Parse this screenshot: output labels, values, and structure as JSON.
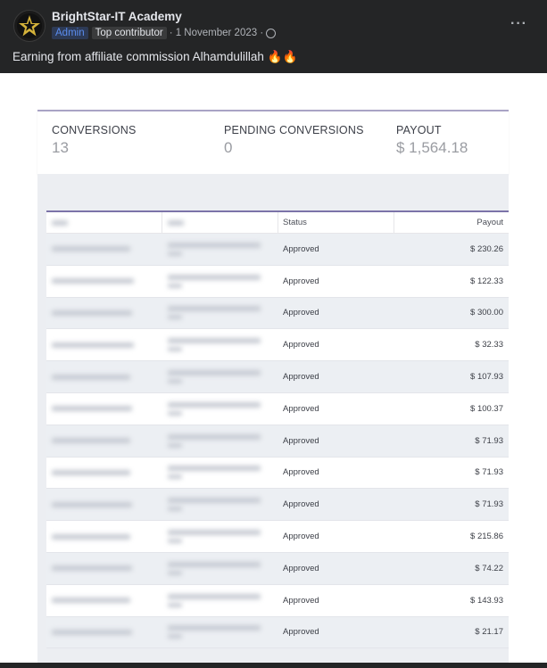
{
  "post": {
    "page_name": "BrightStar-IT Academy",
    "admin_badge": "Admin",
    "top_badge": "Top contributor",
    "date": "· 1 November 2023 ·",
    "caption": "Earning from affiliate commission Alhamdulillah 🔥🔥",
    "more_icon": "···"
  },
  "summary": {
    "conversions_label": "CONVERSIONS",
    "conversions_value": "13",
    "pending_label": "PENDING CONVERSIONS",
    "pending_value": "0",
    "payout_label": "PAYOUT",
    "payout_value": "$ 1,564.18"
  },
  "table": {
    "columns": [
      "",
      "",
      "Status",
      "Payout"
    ],
    "rows": [
      {
        "status": "Approved",
        "payout": "$ 230.26"
      },
      {
        "status": "Approved",
        "payout": "$ 122.33"
      },
      {
        "status": "Approved",
        "payout": "$ 300.00"
      },
      {
        "status": "Approved",
        "payout": "$ 32.33"
      },
      {
        "status": "Approved",
        "payout": "$ 107.93"
      },
      {
        "status": "Approved",
        "payout": "$ 100.37"
      },
      {
        "status": "Approved",
        "payout": "$ 71.93"
      },
      {
        "status": "Approved",
        "payout": "$ 71.93"
      },
      {
        "status": "Approved",
        "payout": "$ 71.93"
      },
      {
        "status": "Approved",
        "payout": "$ 215.86"
      },
      {
        "status": "Approved",
        "payout": "$ 74.22"
      },
      {
        "status": "Approved",
        "payout": "$ 143.93"
      },
      {
        "status": "Approved",
        "payout": "$ 21.17"
      }
    ]
  },
  "colors": {
    "background": "#242526",
    "text_primary": "#e4e6eb",
    "admin_blue": "#5b8def",
    "table_accent": "#7b73a8"
  },
  "icons": {
    "avatar": "star-logo-icon",
    "privacy": "globe-icon",
    "more": "more-options-icon"
  }
}
